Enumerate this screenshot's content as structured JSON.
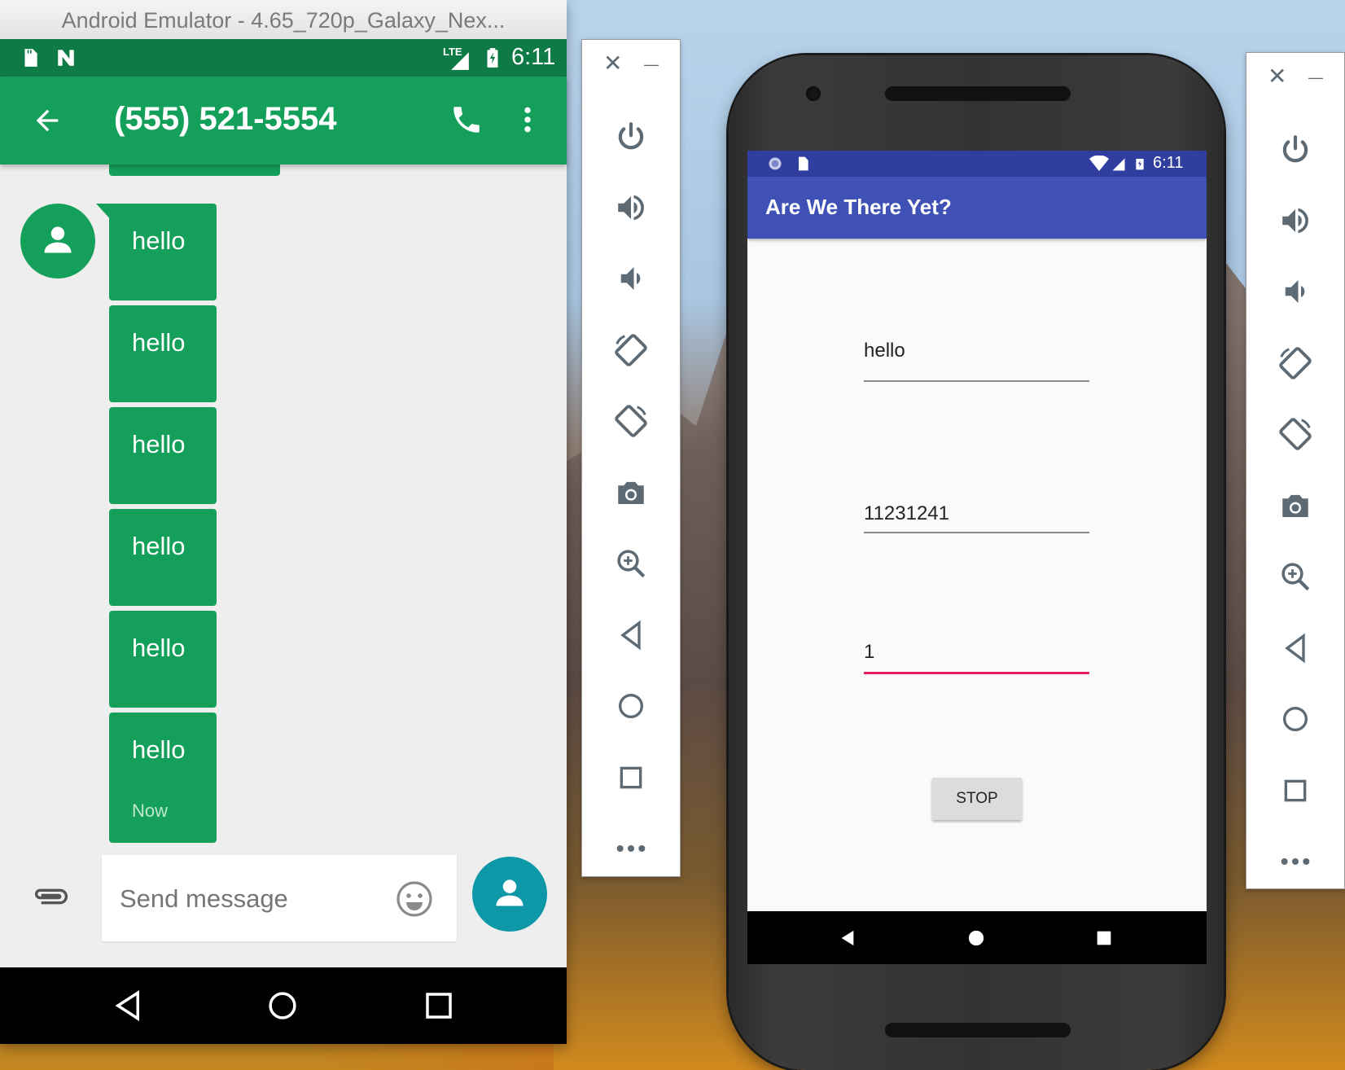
{
  "left_window": {
    "title": "Android Emulator - 4.65_720p_Galaxy_Nex...",
    "status_time": "6:11",
    "network_label": "LTE",
    "contact_title": "(555) 521-5554",
    "messages": [
      "hello",
      "hello",
      "hello",
      "hello",
      "hello",
      "hello"
    ],
    "last_message_time": "Now",
    "compose_placeholder": "Send message",
    "colors": {
      "appbar": "#14a05a",
      "statusbar": "#0e7a45",
      "fab": "#0d97a7"
    }
  },
  "left_toolbar": {
    "close_label": "✕",
    "minimize_label": "—",
    "buttons": [
      "power-icon",
      "volume-up-icon",
      "volume-down-icon",
      "rotate-left-icon",
      "rotate-right-icon",
      "camera-icon",
      "zoom-icon",
      "back-icon",
      "home-icon",
      "overview-icon",
      "more-icon"
    ]
  },
  "right_phone": {
    "status_time": "6:11",
    "app_title": "Are We There Yet?",
    "field_1_value": "hello",
    "field_2_value": "11231241",
    "field_3_value": "1",
    "stop_label": "STOP",
    "colors": {
      "appbar": "#3f51b5",
      "statusbar": "#303f9f",
      "accent": "#e91e63"
    }
  },
  "right_toolbar": {
    "close_label": "✕",
    "minimize_label": "—",
    "buttons": [
      "power-icon",
      "volume-up-icon",
      "volume-down-icon",
      "rotate-left-icon",
      "rotate-right-icon",
      "camera-icon",
      "zoom-icon",
      "back-icon",
      "home-icon",
      "overview-icon",
      "more-icon"
    ]
  }
}
